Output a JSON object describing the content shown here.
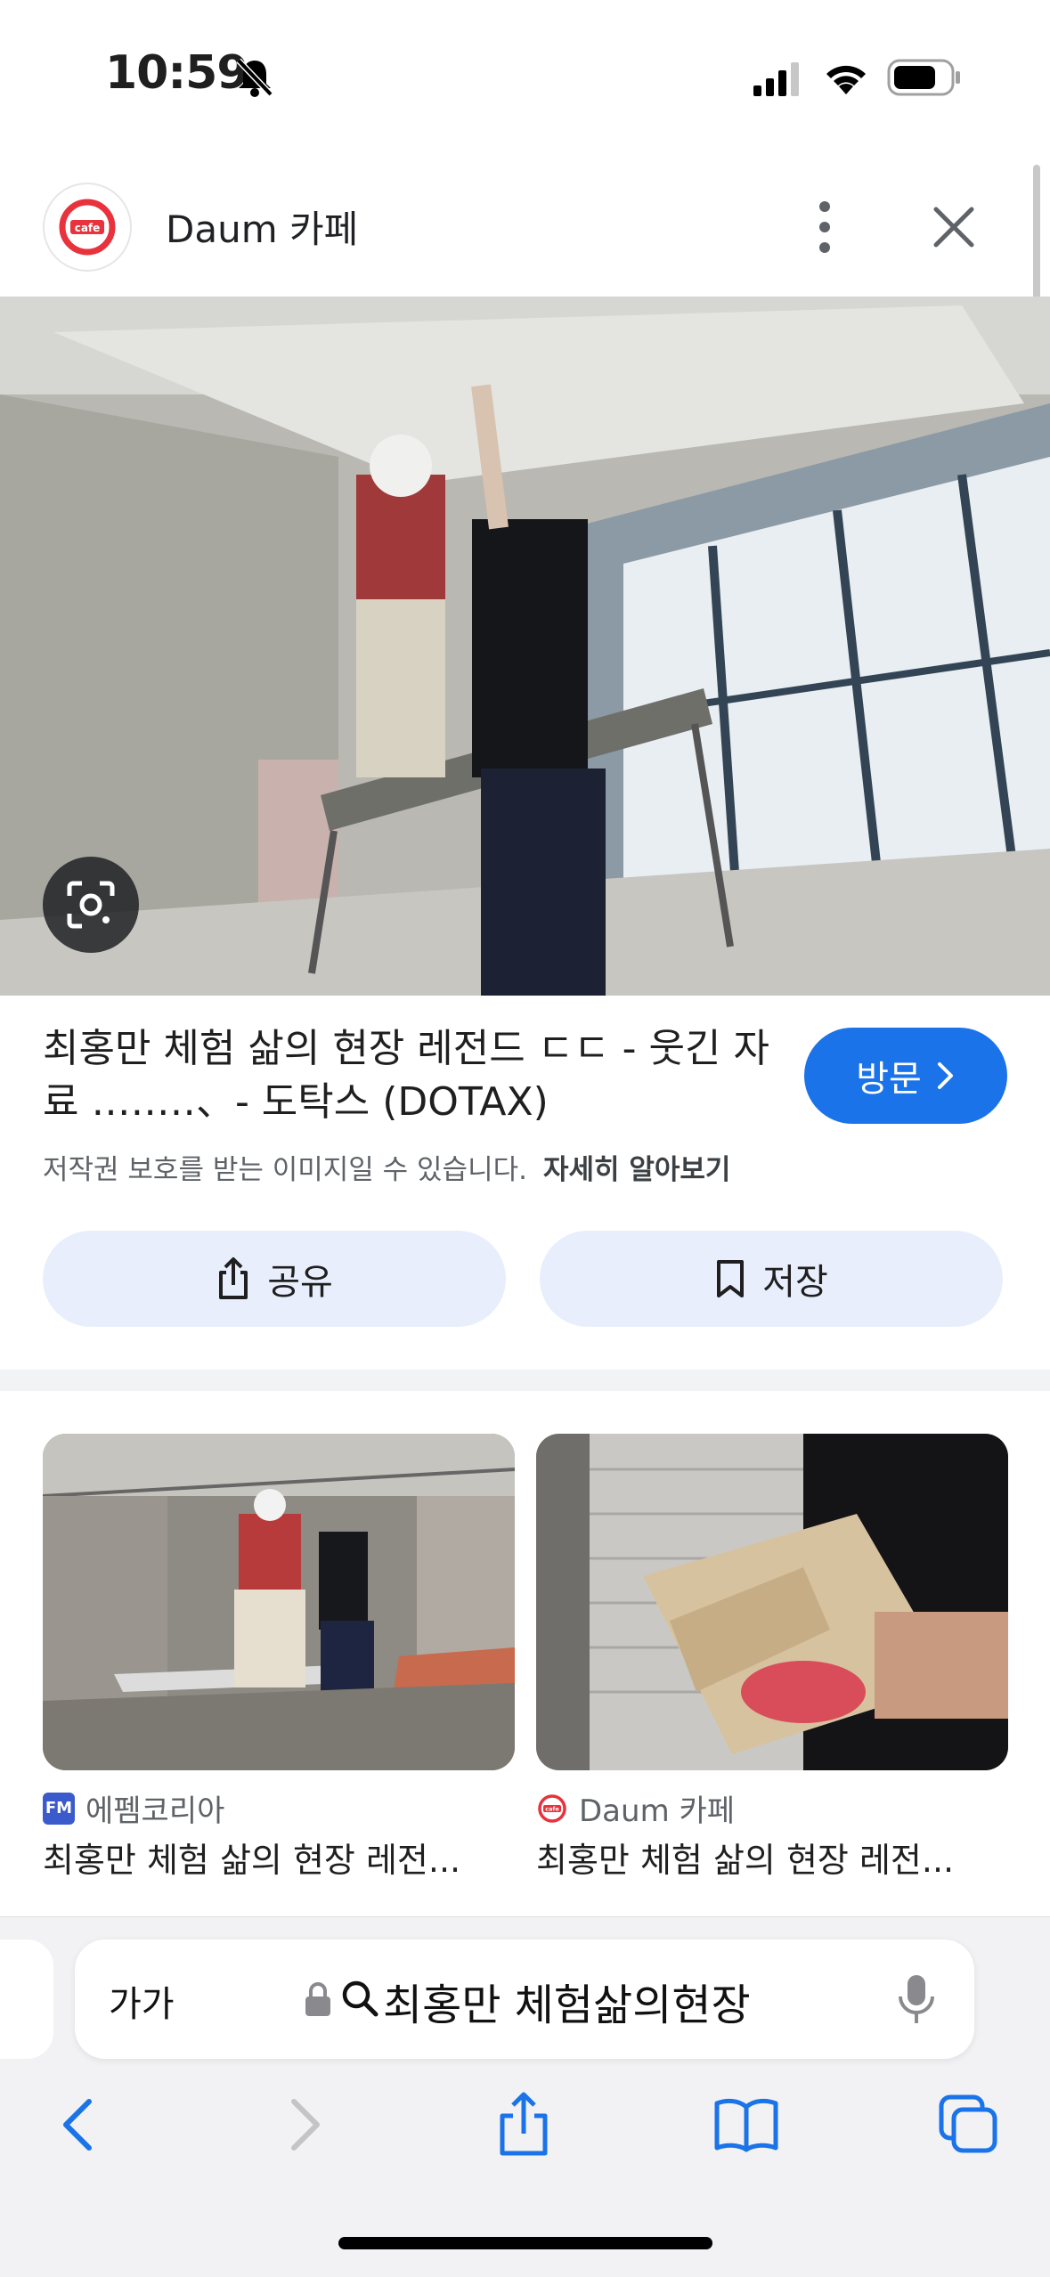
{
  "status_bar": {
    "time": "10:59"
  },
  "header": {
    "source_name": "Daum 카페",
    "logo_text": "cafe"
  },
  "result": {
    "title": "최홍만 체험 삶의 현장 레전드 ㄷㄷ - 웃긴 자료 ‥‥‥‥、- 도탁스 (DOTAX)",
    "visit_label": "방문",
    "copyright_notice": "저작권 보호를 받는 이미지일 수 있습니다.",
    "learn_more": "자세히 알아보기",
    "share_label": "공유",
    "save_label": "저장"
  },
  "related": [
    {
      "source": "에펨코리아",
      "source_badge": "FM",
      "title": "최홍만 체험 삶의 현장 레전..."
    },
    {
      "source": "Daum 카페",
      "source_badge": "cafe",
      "title": "최홍만 체험 삶의 현장 레전..."
    }
  ],
  "browser": {
    "aa_label": "가가",
    "url_text": "최홍만 체험삶의현장"
  },
  "colors": {
    "accent": "#1a73e8",
    "pill_bg": "#e8eefb",
    "daum_red": "#e8323c"
  }
}
